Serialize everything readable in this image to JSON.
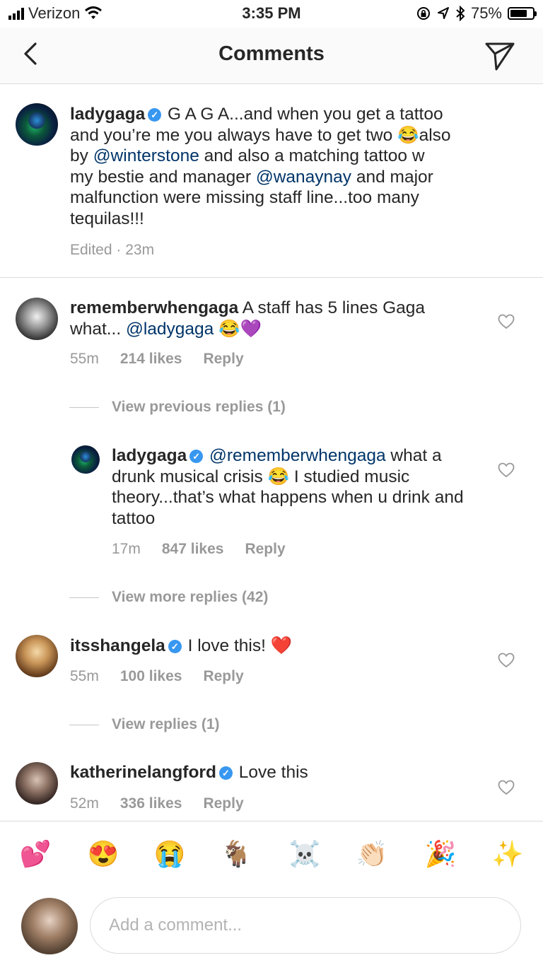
{
  "status_bar": {
    "carrier": "Verizon",
    "time": "3:35 PM",
    "battery_text": "75%",
    "battery_level": 0.75
  },
  "header": {
    "title": "Comments"
  },
  "caption": {
    "username": "ladygaga",
    "parts": [
      " G A G A...and when you get a tattoo and you’re me you always have to get two ",
      "😂",
      "also by ",
      "@winterstone",
      " and also a matching tattoo w my bestie and manager ",
      "@wanaynay",
      " and major malfunction were missing staff line...too many tequilas!!!"
    ],
    "meta": "Edited · 23m"
  },
  "comments": [
    {
      "username": "rememberwhengaga",
      "parts": [
        " A staff has 5 lines Gaga what... ",
        "@ladygaga",
        " 😂💜"
      ],
      "time": "55m",
      "likes": "214 likes",
      "reply": "Reply"
    },
    {
      "view_previous": "View previous replies (1)",
      "username": "ladygaga",
      "parts": [
        " ",
        "@rememberwhengaga",
        " what a drunk musical crisis 😂 I studied music theory...that’s what happens when u drink and tattoo"
      ],
      "time": "17m",
      "likes": "847 likes",
      "reply": "Reply",
      "view_more": "View more replies (42)"
    },
    {
      "username": "itsshangela",
      "parts": [
        " I love this! ",
        "❤️"
      ],
      "time": "55m",
      "likes": "100 likes",
      "reply": "Reply",
      "view_replies": "View replies (1)"
    },
    {
      "username": "katherinelangford",
      "parts": [
        " Love this"
      ],
      "time": "52m",
      "likes": "336 likes",
      "reply": "Reply"
    }
  ],
  "emoji_bar": [
    "💕",
    "😍",
    "😭",
    "🐐",
    "☠️",
    "👏🏻",
    "🎉",
    "✨"
  ],
  "composer": {
    "placeholder": "Add a comment..."
  },
  "icons": {
    "back": "chevron-left-icon",
    "send": "paper-plane-icon",
    "like": "heart-outline-icon",
    "verified": "verified-badge-icon"
  },
  "colors": {
    "link": "#003569",
    "verified": "#3897f0",
    "muted": "#999999"
  }
}
